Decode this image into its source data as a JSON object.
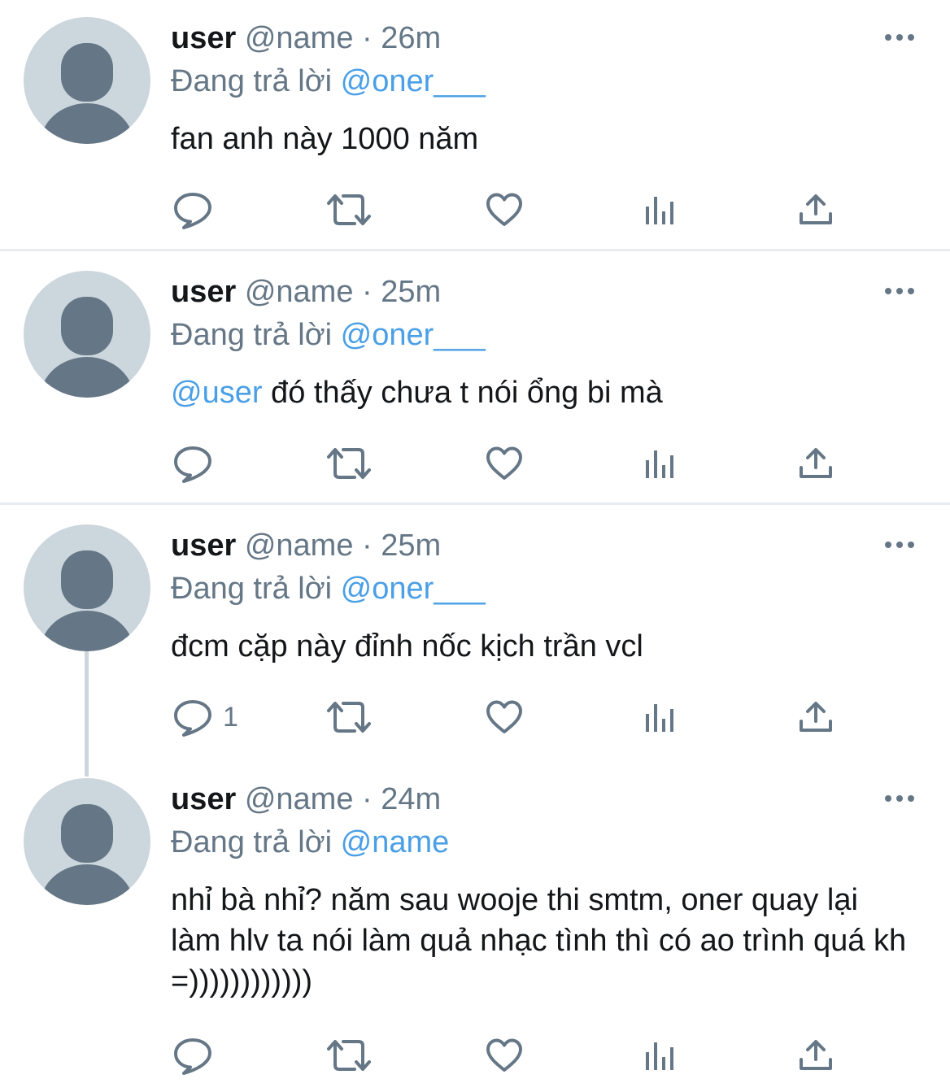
{
  "colors": {
    "accent": "#4a9fe6",
    "secondary": "#657786",
    "avatar_bg": "#ccd6dd",
    "avatar_fg": "#657786"
  },
  "icons": {
    "reply": "reply-bubble-icon",
    "retweet": "retweet-icon",
    "like": "heart-icon",
    "analytics": "analytics-bars-icon",
    "share": "share-upload-icon",
    "more": "more-dots-icon",
    "avatar": "default-avatar-icon"
  },
  "tweets": [
    {
      "display_name": "user",
      "handle": "@name",
      "separator": "·",
      "time": "26m",
      "replying_prefix": "Đang trả lời",
      "replying_to": "@oner___",
      "mention": "",
      "text": "fan anh này 1000 năm",
      "reply_count": ""
    },
    {
      "display_name": "user",
      "handle": "@name",
      "separator": "·",
      "time": "25m",
      "replying_prefix": "Đang trả lời",
      "replying_to": "@oner___",
      "mention": "@user",
      "text": " đó thấy chưa t nói ổng bi mà",
      "reply_count": ""
    },
    {
      "display_name": "user",
      "handle": "@name",
      "separator": "·",
      "time": "25m",
      "replying_prefix": "Đang trả lời",
      "replying_to": "@oner___",
      "mention": "",
      "text": "đcm cặp này đỉnh nốc kịch trần vcl",
      "reply_count": "1"
    },
    {
      "display_name": "user",
      "handle": "@name",
      "separator": "·",
      "time": "24m",
      "replying_prefix": "Đang trả lời",
      "replying_to": "@name",
      "mention": "",
      "text": "nhỉ bà nhỉ? năm sau wooje thi smtm, oner quay lại làm hlv ta nói làm quả nhạc tình thì có ao trình quá kh =))))))))))))",
      "reply_count": ""
    }
  ]
}
